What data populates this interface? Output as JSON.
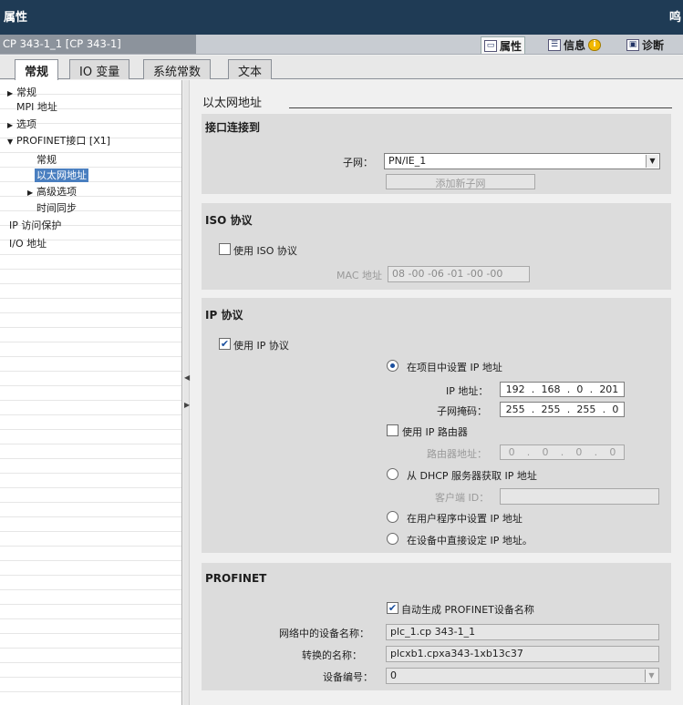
{
  "window": {
    "title": "属性",
    "right_fragment": "鸣"
  },
  "objectbar": {
    "object_name": "CP 343-1_1 [CP 343-1]",
    "tabs": [
      {
        "label": "属性",
        "icon": "properties-icon",
        "active": true
      },
      {
        "label": "信息",
        "icon": "info-list-icon",
        "active": false
      },
      {
        "label": "诊断",
        "icon": "diagnostics-icon",
        "active": false
      }
    ],
    "info_icon_glyph": "i"
  },
  "tabs": [
    "常规",
    "IO 变量",
    "系统常数",
    "文本"
  ],
  "nav": {
    "items": [
      {
        "label": "常规",
        "expander": "▶"
      },
      {
        "label": "MPI 地址"
      },
      {
        "label": "选项",
        "expander": "▶"
      },
      {
        "label": "PROFINET接口 [X1]",
        "expander": "▼"
      },
      {
        "label": "常规"
      },
      {
        "label": "以太网地址",
        "selected": true
      },
      {
        "label": "高级选项",
        "expander": "▶"
      },
      {
        "label": "时间同步"
      },
      {
        "label": "IP 访问保护"
      },
      {
        "label": "I/O 地址"
      }
    ]
  },
  "section_title": "以太网地址",
  "interface": {
    "title": "接口连接到",
    "subnet_label": "子网：",
    "subnet_value": "PN/IE_1",
    "add_subnet_button": "添加新子网"
  },
  "iso": {
    "title": "ISO 协议",
    "use_iso_label": "使用 ISO 协议",
    "use_iso_checked": false,
    "mac_label": "MAC 地址",
    "mac_value": "08 -00 -06 -01 -00 -00"
  },
  "ip": {
    "title": "IP 协议",
    "use_ip_label": "使用 IP 协议",
    "use_ip_checked": true,
    "set_in_project": "在项目中设置 IP 地址",
    "ip_label": "IP 地址：",
    "ip_octets": [
      "192",
      "168",
      "0",
      "201"
    ],
    "mask_label": "子网掩码：",
    "mask_octets": [
      "255",
      "255",
      "255",
      "0"
    ],
    "use_router_label": "使用 IP 路由器",
    "use_router_checked": false,
    "router_label": "路由器地址：",
    "router_octets": [
      "0",
      "0",
      "0",
      "0"
    ],
    "dhcp_label": "从 DHCP 服务器获取 IP 地址",
    "client_id_label": "客户端 ID：",
    "client_id_value": "",
    "user_program_label": "在用户程序中设置 IP 地址",
    "device_direct_label": "在设备中直接设定 IP 地址。"
  },
  "profinet": {
    "title": "PROFINET",
    "auto_name_label": "自动生成 PROFINET设备名称",
    "auto_name_checked": true,
    "device_name_label": "网络中的设备名称：",
    "device_name_value": "plc_1.cp 343-1_1",
    "converted_label": "转换的名称：",
    "converted_value": "plcxb1.cpxa343-1xb13c37",
    "device_no_label": "设备编号：",
    "device_no_value": "0"
  },
  "glyphs": {
    "check": "✔",
    "dropdown": "▼",
    "split_left": "◀",
    "split_right": "▶",
    "ip_dot": "."
  }
}
